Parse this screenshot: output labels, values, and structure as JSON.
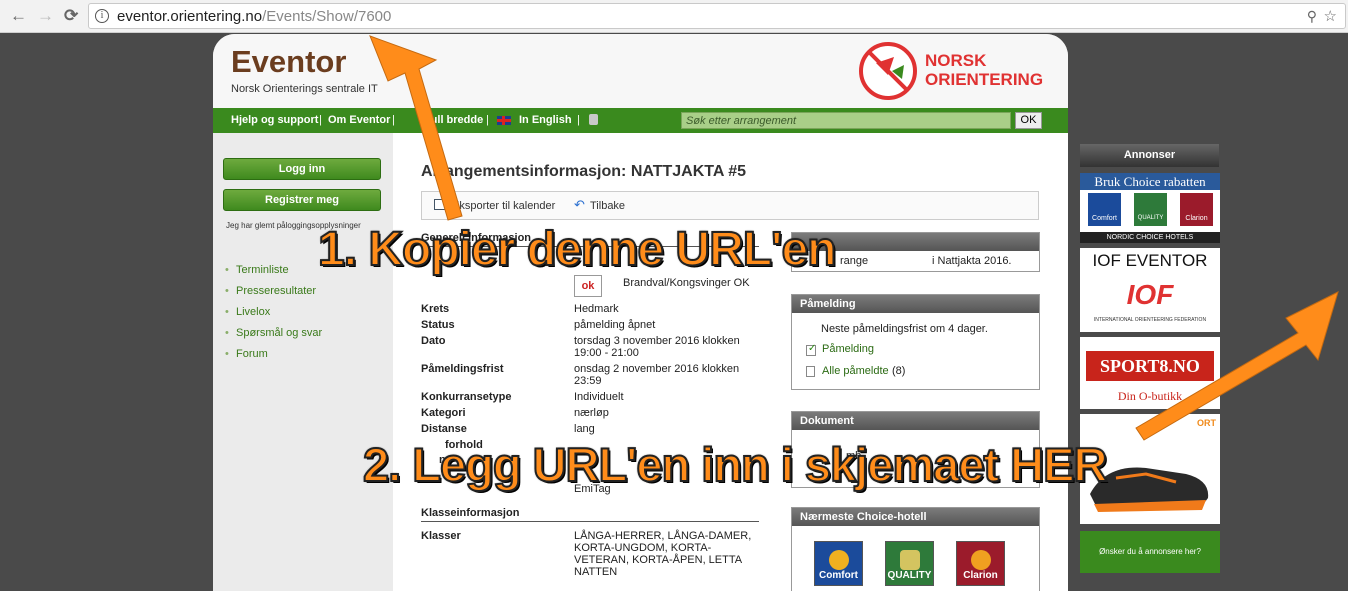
{
  "browser": {
    "back": "←",
    "forward": "→",
    "reload": "C",
    "url_domain": "eventor.orientering.no",
    "url_path": "/Events/Show/7600",
    "zoom_icon": "zoom-icon",
    "star_icon": "star-icon"
  },
  "header": {
    "logo": "Eventor",
    "subtitle": "Norsk Orienterings sentrale IT",
    "brand_line1": "NORSK",
    "brand_line2": "ORIENTERING"
  },
  "topnav": {
    "help": "Hjelp og support",
    "about": "Om Eventor",
    "fullwidth": "full bredde",
    "english": "In English",
    "sep": "|",
    "search_placeholder": "Søk etter arrangement",
    "ok": "OK"
  },
  "sidebar": {
    "login": "Logg inn",
    "register": "Registrer meg",
    "forgot": "Jeg har glemt påloggingsopplysninger",
    "links": [
      "Terminliste",
      "Presseresultater",
      "Livelox",
      "Spørsmål og svar",
      "Forum"
    ]
  },
  "main": {
    "title": "Arrangementsinformasjon: NATTJAKTA #5",
    "export": "Eksporter til kalender",
    "back": "Tilbake",
    "general_title": "Generell informasjon",
    "organizer": "Brandval/Kongsvinger OK",
    "org_badge": "ok",
    "rows": [
      {
        "label": "Krets",
        "value": "Hedmark"
      },
      {
        "label": "Status",
        "value": "påmelding åpnet"
      },
      {
        "label": "Dato",
        "value": "torsdag 3 november 2016 klokken 19:00 - 21:00"
      },
      {
        "label": "Påmeldingsfrist",
        "value": "onsdag 2 november 2016 klokken 23:59"
      },
      {
        "label": "Konkurransetype",
        "value": "Individuelt"
      },
      {
        "label": "Kategori",
        "value": "nærløp"
      },
      {
        "label": "Distanse",
        "value": "lang"
      },
      {
        "label": "forhold",
        "value": ""
      },
      {
        "label": "n",
        "value": ""
      }
    ],
    "emitag": "EmiTag",
    "class_title": "Klasseinformasjon",
    "klasser_label": "Klasser",
    "klasser_value": "LÅNGA-HERRER, LÅNGA-DAMER, KORTA-UNGDOM, KORTA-VETERAN, KORTA-ÅPEN, LETTA NATTEN"
  },
  "right_boxes": {
    "info_prefix": "range",
    "info_text": "i Nattjakta 2016.",
    "pamelding_title": "Påmelding",
    "next_deadline": "Neste påmeldingsfrist om 4 dager.",
    "pamelding_link": "Påmelding",
    "all_entries": "Alle påmeldte",
    "all_count": "(8)",
    "doc_title": "Dokument",
    "doc_partial": "mb",
    "hotel_title": "Nærmeste Choice-hotell",
    "hotels": [
      "Comfort",
      "QUALITY",
      "Clarion"
    ]
  },
  "ads": {
    "title": "Annonser",
    "choice_banner": "Bruk Choice rabatten",
    "choice_brands": [
      "Comfort",
      "QUALITY",
      "Clarion"
    ],
    "nordic": "NORDIC CHOICE HOTELS",
    "iof_title": "IOF EVENTOR",
    "iof_logo": "IOF",
    "iof_sub": "INTERNATIONAL ORIENTEERING FEDERATION",
    "sport8": "SPORT8.NO",
    "sport8_sub": "Din O-butikk",
    "shoe_brand": "ORT",
    "advertise": "Ønsker du å annonsere her?"
  },
  "overlays": {
    "step1": "1. Kopier denne URL'en",
    "step2": "2. Legg URL'en inn i skjemaet HER",
    "arrow_color": "#ff8c1a"
  }
}
